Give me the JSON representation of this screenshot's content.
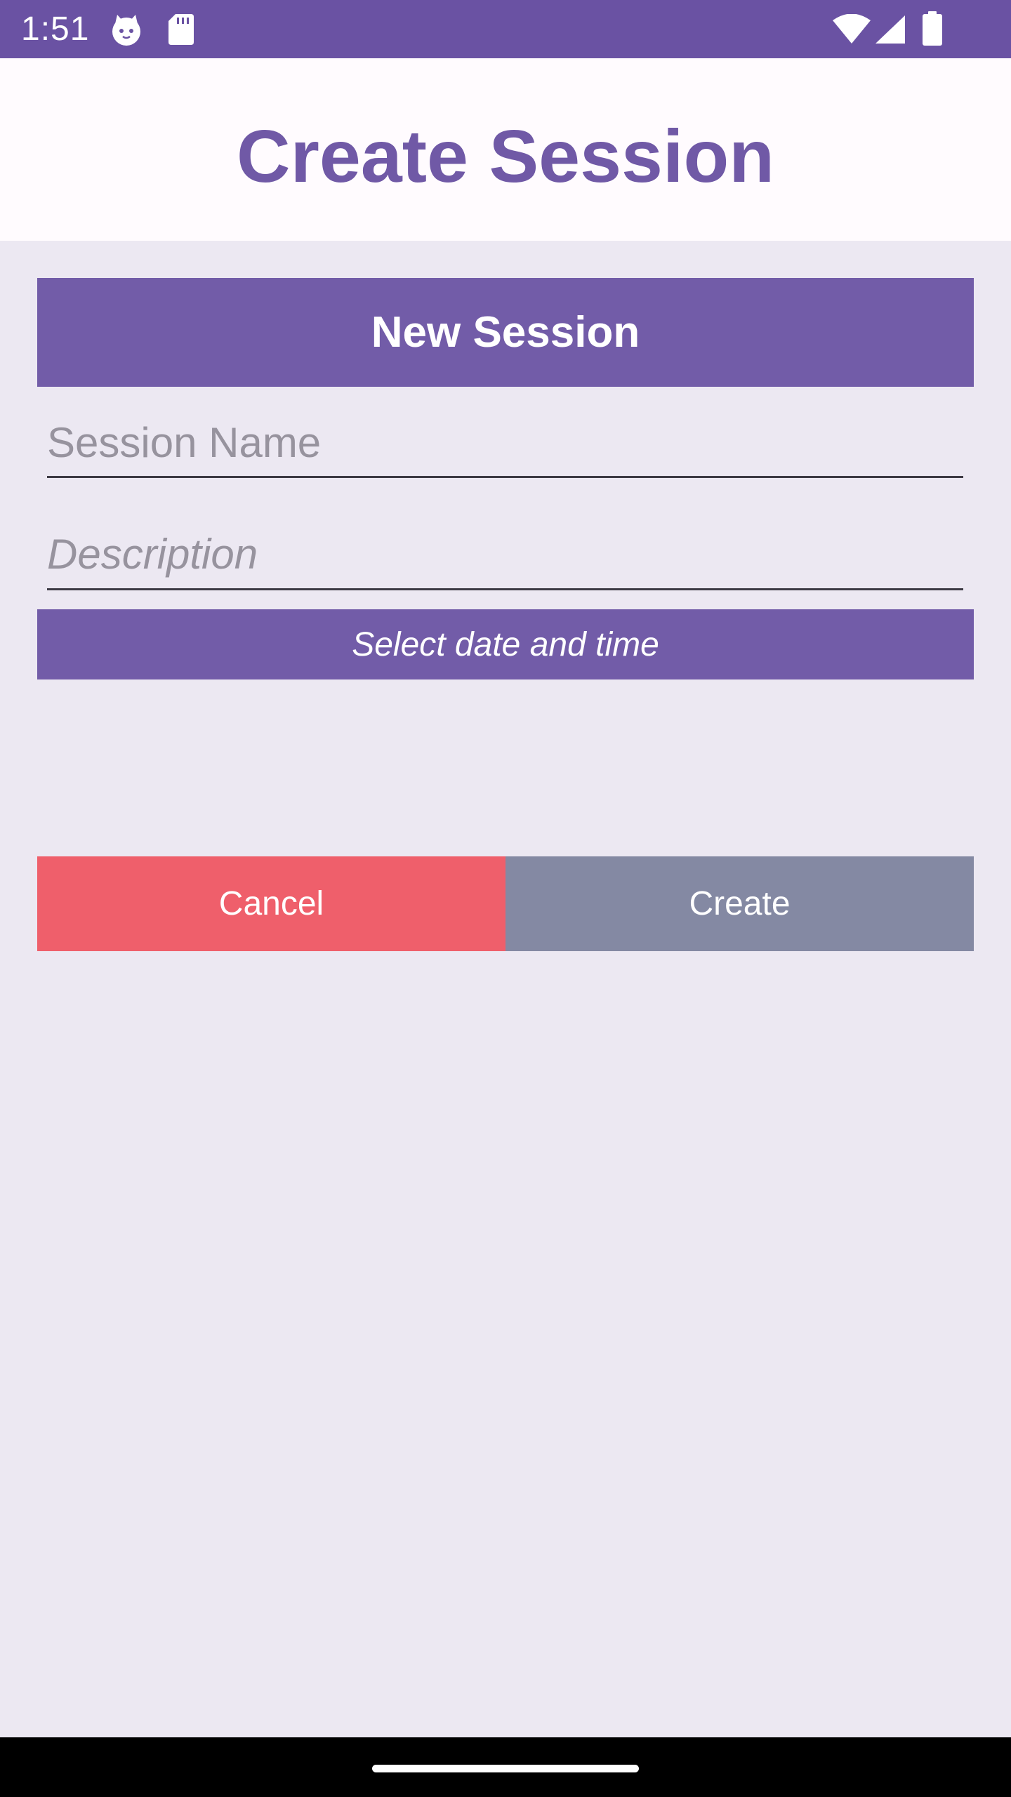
{
  "status_bar": {
    "time": "1:51",
    "icons": [
      "cat-notification-icon",
      "sd-card-icon",
      "wifi-icon",
      "cellular-signal-icon",
      "battery-icon"
    ]
  },
  "header": {
    "title": "Create Session"
  },
  "form": {
    "section_title": "New Session",
    "session_name": {
      "value": "",
      "placeholder": "Session Name"
    },
    "description": {
      "value": "",
      "placeholder": "Description"
    },
    "datetime_label": "Select date and time"
  },
  "actions": {
    "cancel_label": "Cancel",
    "create_label": "Create"
  },
  "colors": {
    "primary": "#6A52A3",
    "card": "#725CA8",
    "background": "#ECE8F2",
    "cancel": "#EF5F6B",
    "create": "#8489A3"
  }
}
